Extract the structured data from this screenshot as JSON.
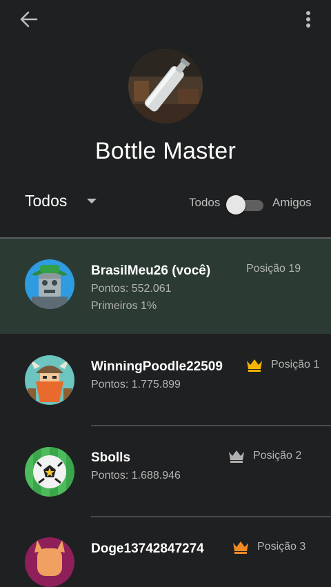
{
  "header": {
    "back_icon": "arrow-left-icon",
    "menu_icon": "more-vertical-icon"
  },
  "game": {
    "title": "Bottle Master"
  },
  "filters": {
    "scope_selected": "Todos",
    "toggle_left_label": "Todos",
    "toggle_right_label": "Amigos",
    "toggle_on": false
  },
  "leaderboard": {
    "current_user": {
      "name": "BrasilMeu26 (você)",
      "points": "Pontos: 552.061",
      "percentile": "Primeiros 1%",
      "position": "Posição 19"
    },
    "entries": [
      {
        "name": "WinningPoodle22509",
        "points": "Pontos: 1.775.899",
        "position": "Posição 1",
        "crown_color": "#f4b400"
      },
      {
        "name": "Sbolls",
        "points": "Pontos: 1.688.946",
        "position": "Posição 2",
        "crown_color": "#b0b0b0"
      },
      {
        "name": "Doge13742847274",
        "points": "",
        "position": "Posição 3",
        "crown_color": "#f08a24"
      }
    ]
  },
  "colors": {
    "background": "#1f2021",
    "highlight_row": "#2b3b33",
    "text_secondary": "#b4b4b4"
  }
}
